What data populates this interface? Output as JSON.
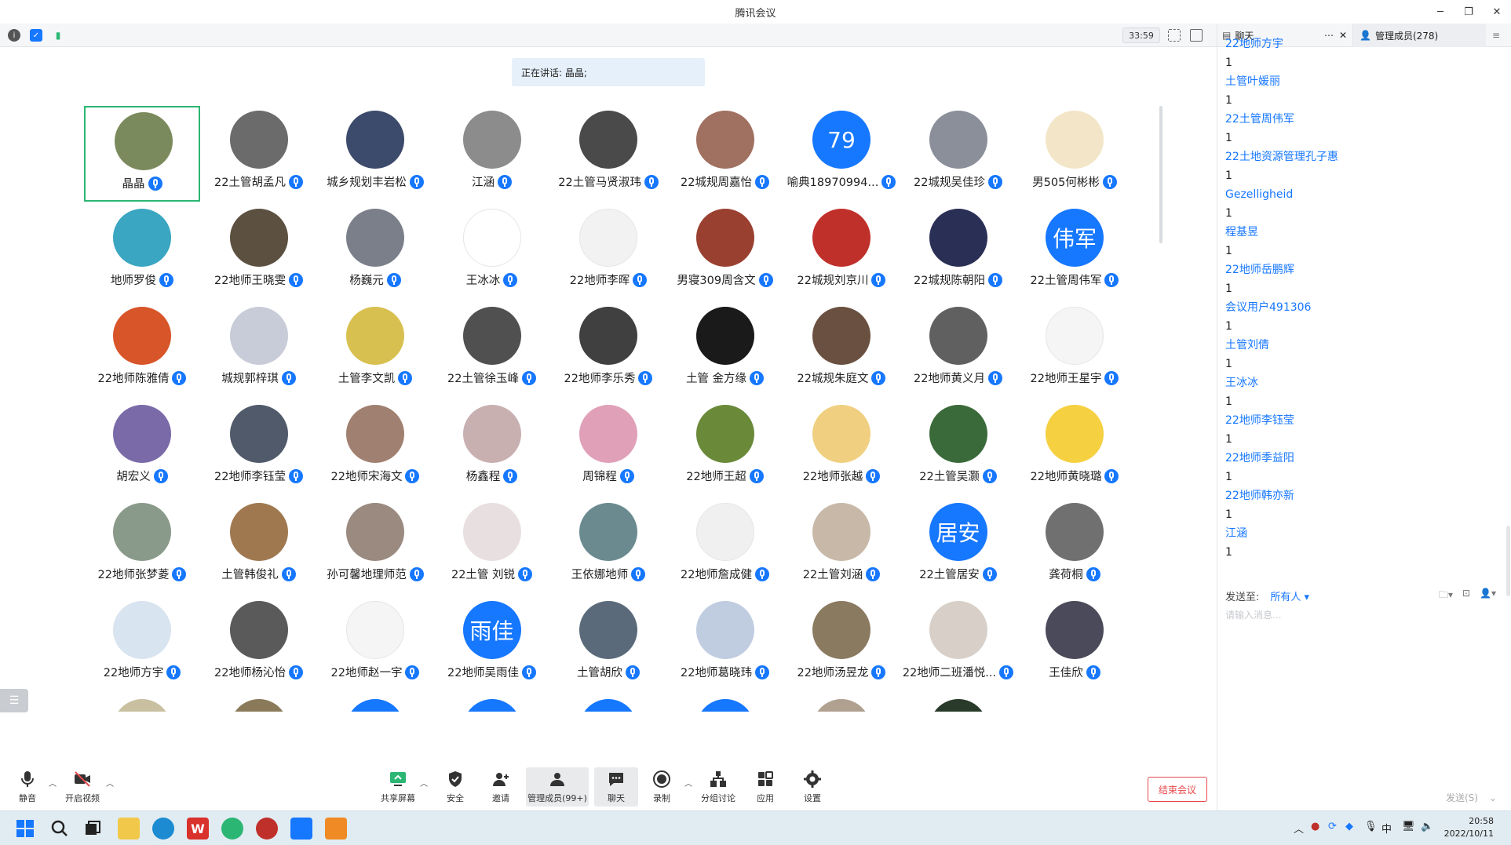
{
  "window": {
    "title": "腾讯会议",
    "controls": [
      "minimize-icon",
      "restore-icon",
      "close-icon"
    ]
  },
  "infobar": {
    "timer": "33:59"
  },
  "speaking": {
    "text": "正在讲话: 晶晶;"
  },
  "participants": [
    {
      "name": "晶晶",
      "color": "#7b8a5c",
      "active": true
    },
    {
      "name": "22土管胡孟凡",
      "color": "#6b6b6b"
    },
    {
      "name": "城乡规划丰岩松",
      "color": "#3c4a6b"
    },
    {
      "name": "江涵",
      "color": "#8c8c8c"
    },
    {
      "name": "22土管马贤淑玮",
      "color": "#4a4a4a"
    },
    {
      "name": "22城规周嘉怡",
      "color": "#a07060"
    },
    {
      "name": "喻典18970994...",
      "color": "#1677ff",
      "text": "79"
    },
    {
      "name": "22城规吴佳珍",
      "color": "#8a8f9a"
    },
    {
      "name": "男505何彬彬",
      "color": "#f3e6c8"
    },
    {
      "name": "地师罗俊",
      "color": "#3aa6c2"
    },
    {
      "name": "22地师王晓雯",
      "color": "#5c5040"
    },
    {
      "name": "杨巍元",
      "color": "#7a7f8a"
    },
    {
      "name": "王冰冰",
      "color": "#ffffff"
    },
    {
      "name": "22地师李晖",
      "color": "#f2f2f2"
    },
    {
      "name": "男寝309周含文",
      "color": "#9a4030"
    },
    {
      "name": "22城规刘京川",
      "color": "#c0302a"
    },
    {
      "name": "22城规陈朝阳",
      "color": "#2a2f55"
    },
    {
      "name": "22土管周伟军",
      "color": "#1677ff",
      "text": "伟军"
    },
    {
      "name": "22地师陈雅倩",
      "color": "#d8552a"
    },
    {
      "name": "城规郭梓琪",
      "color": "#c8ccd8"
    },
    {
      "name": "土管李文凯",
      "color": "#d8c050"
    },
    {
      "name": "22土管徐玉峰",
      "color": "#505050"
    },
    {
      "name": "22地师李乐秀",
      "color": "#404040"
    },
    {
      "name": "土管 金方缘",
      "color": "#1a1a1a"
    },
    {
      "name": "22城规朱庭文",
      "color": "#6a5040"
    },
    {
      "name": "22地师黄义月",
      "color": "#606060"
    },
    {
      "name": "22地师王星宇",
      "color": "#f5f5f5"
    },
    {
      "name": "胡宏义",
      "color": "#7a6aa8"
    },
    {
      "name": "22地师李钰莹",
      "color": "#505a6a"
    },
    {
      "name": "22地师宋海文",
      "color": "#a08070"
    },
    {
      "name": "杨鑫程",
      "color": "#c8b0b0"
    },
    {
      "name": "周锦程",
      "color": "#e0a0b8"
    },
    {
      "name": "22地师王超",
      "color": "#6a8a3a"
    },
    {
      "name": "22地师张越",
      "color": "#f0d080"
    },
    {
      "name": "22土管吴灏",
      "color": "#3a6a3a"
    },
    {
      "name": "22地师黄晓璐",
      "color": "#f5d040"
    },
    {
      "name": "22地师张梦菱",
      "color": "#8a9a8a"
    },
    {
      "name": "土管韩俊礼",
      "color": "#a07850"
    },
    {
      "name": "孙可馨地理师范",
      "color": "#9a8a80"
    },
    {
      "name": "22土管 刘锐",
      "color": "#e8e0e0"
    },
    {
      "name": "王依娜地师",
      "color": "#6a8a90"
    },
    {
      "name": "22地师詹成健",
      "color": "#f0f0f0"
    },
    {
      "name": "22土管刘涵",
      "color": "#c8b8a8"
    },
    {
      "name": "22土管居安",
      "color": "#1677ff",
      "text": "居安"
    },
    {
      "name": "龚荷桐",
      "color": "#707070"
    },
    {
      "name": "22地师方宇",
      "color": "#d8e4f0"
    },
    {
      "name": "22地师杨沁怡",
      "color": "#5a5a5a"
    },
    {
      "name": "22地师赵一宇",
      "color": "#f5f5f5"
    },
    {
      "name": "22地师吴雨佳",
      "color": "#1677ff",
      "text": "雨佳"
    },
    {
      "name": "土管胡欣",
      "color": "#5a6a7a"
    },
    {
      "name": "22地师葛晓玮",
      "color": "#c0cce0"
    },
    {
      "name": "22地师汤昱龙",
      "color": "#8a7a60"
    },
    {
      "name": "22地师二班潘悦...",
      "color": "#d8d0c8"
    },
    {
      "name": "王佳欣",
      "color": "#4a4a5a"
    },
    {
      "name": "",
      "color": "#c8c0a0"
    },
    {
      "name": "",
      "color": "#8a7a5a"
    },
    {
      "name": "",
      "color": "#1677ff"
    },
    {
      "name": "",
      "color": "#1677ff"
    },
    {
      "name": "",
      "color": "#1677ff"
    },
    {
      "name": "",
      "color": "#1677ff"
    },
    {
      "name": "",
      "color": "#b0a090"
    },
    {
      "name": "",
      "color": "#2a3a2a"
    }
  ],
  "toolbar": {
    "mute": "静音",
    "video": "开启视频",
    "share": "共享屏幕",
    "security": "安全",
    "invite": "邀请",
    "members": "管理成员(99+)",
    "chat": "聊天",
    "record": "录制",
    "breakout": "分组讨论",
    "apps": "应用",
    "settings": "设置",
    "end": "结束会议"
  },
  "panel": {
    "chat_tab": "聊天",
    "members_tab": "管理成员(278)",
    "messages": [
      {
        "sender": "22地师方宇",
        "text": "1"
      },
      {
        "sender": "土管叶媛丽",
        "text": "1"
      },
      {
        "sender": "22土管周伟军",
        "text": "1"
      },
      {
        "sender": "22土地资源管理孔子惠",
        "text": "1"
      },
      {
        "sender": "Gezelligheid",
        "text": "1"
      },
      {
        "sender": "程基昱",
        "text": "1"
      },
      {
        "sender": "22地师岳鹏辉",
        "text": "1"
      },
      {
        "sender": "会议用户491306",
        "text": "1"
      },
      {
        "sender": "土管刘倩",
        "text": "1"
      },
      {
        "sender": "王冰冰",
        "text": "1"
      },
      {
        "sender": "22地师李钰莹",
        "text": "1"
      },
      {
        "sender": "22地师季益阳",
        "text": "1"
      },
      {
        "sender": "22地师韩亦新",
        "text": "1"
      },
      {
        "sender": "江涵",
        "text": "1"
      }
    ],
    "send_to_label": "发送至:",
    "send_to_value": "所有人 ▾",
    "input_placeholder": "请输入消息...",
    "send_button": "发送(S)"
  },
  "taskbar": {
    "clock_time": "20:58",
    "clock_date": "2022/10/11",
    "ime": "中"
  }
}
